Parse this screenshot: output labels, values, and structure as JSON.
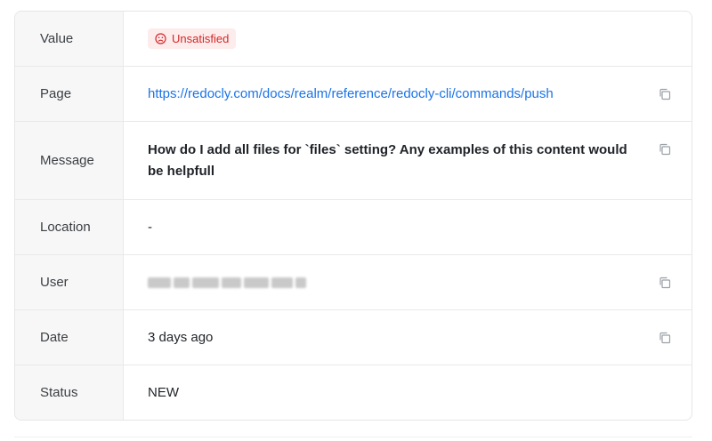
{
  "rows": {
    "value": {
      "label": "Value",
      "badge": "Unsatisfied"
    },
    "page": {
      "label": "Page",
      "url": "https://redocly.com/docs/realm/reference/redocly-cli/commands/push"
    },
    "message": {
      "label": "Message",
      "text": "How do I add all files for `files` setting? Any examples of this content would be helpfull"
    },
    "location": {
      "label": "Location",
      "text": "-"
    },
    "user": {
      "label": "User"
    },
    "date": {
      "label": "Date",
      "text": "3 days ago"
    },
    "status": {
      "label": "Status",
      "text": "NEW"
    }
  },
  "icons": {
    "badge": "sad-face-icon",
    "copy": "copy-icon"
  },
  "colors": {
    "badge_bg": "#fdecec",
    "badge_text": "#d42727",
    "link": "#1a73e8",
    "label_bg": "#f7f7f8"
  }
}
